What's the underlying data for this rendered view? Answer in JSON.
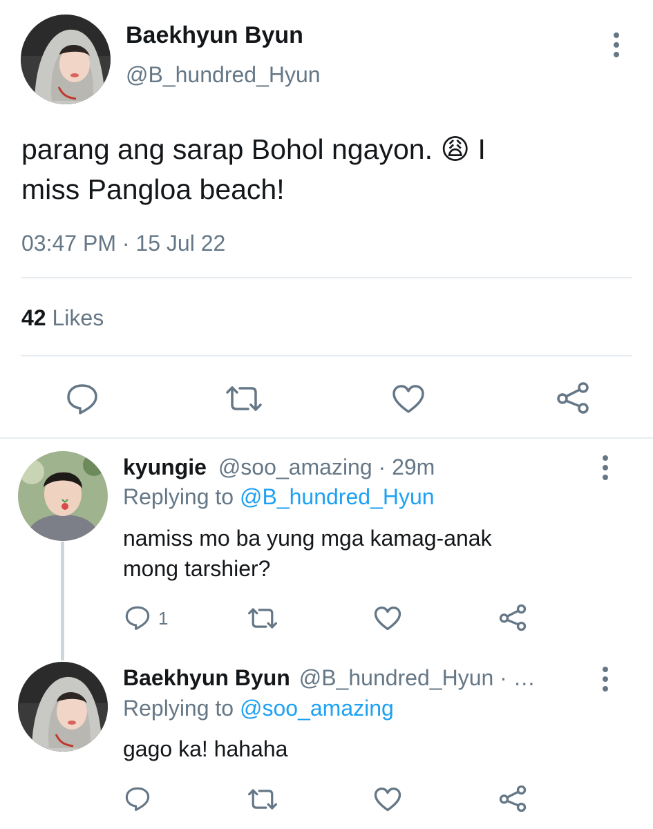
{
  "main_tweet": {
    "display_name": "Baekhyun Byun",
    "handle": "@B_hundred_Hyun",
    "text_line1": "parang ang sarap Bohol ngayon. 😩  I",
    "text_line2": "miss Pangloa beach!",
    "timestamp": "03:47 PM · 15 Jul 22",
    "likes_count": "42",
    "likes_label": "Likes"
  },
  "replies": [
    {
      "display_name": "kyungie",
      "handle_time": "@soo_amazing · 29m",
      "replying_prefix": "Replying to",
      "replying_handle": "@B_hundred_Hyun",
      "text_line1": "namiss mo ba yung mga kamag-anak",
      "text_line2": "mong tarshier?",
      "reply_count": "1"
    },
    {
      "display_name": "Baekhyun Byun",
      "handle_time": "@B_hundred_Hyun · …",
      "replying_prefix": "Replying to",
      "replying_handle": "@soo_amazing",
      "text_line1": "gago ka! hahaha"
    }
  ],
  "colors": {
    "text": "#14171a",
    "secondary": "#657786",
    "link": "#1da1f2",
    "divider": "#e6ecf0"
  },
  "icons": [
    "more-icon",
    "reply-icon",
    "retweet-icon",
    "like-icon",
    "share-icon"
  ]
}
